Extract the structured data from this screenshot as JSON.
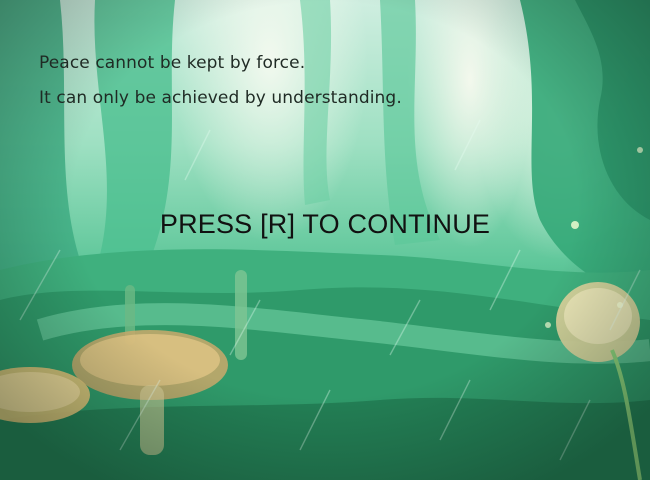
{
  "dialogue": {
    "line1": "Peace cannot be kept by force.",
    "line2": "It can only be achieved by understanding."
  },
  "prompt": {
    "text": "PRESS [R] TO CONTINUE"
  },
  "colors": {
    "text": "#1f2a24",
    "prompt": "#111111",
    "forest": "#2f9e6c"
  }
}
